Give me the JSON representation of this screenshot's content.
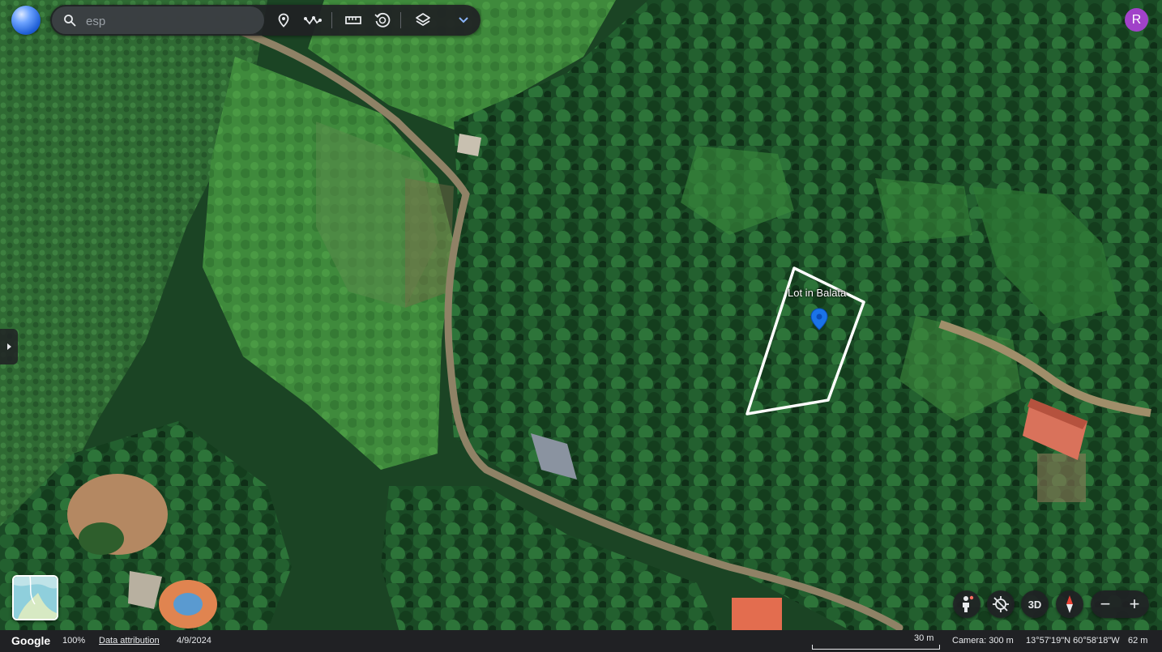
{
  "search": {
    "value": "esp"
  },
  "toolbar": {
    "icons": [
      "pin-icon",
      "path-icon",
      "ruler-icon",
      "history-icon",
      "layers-icon",
      "chevron-down-icon"
    ]
  },
  "user": {
    "initial": "R",
    "color": "#a142c9"
  },
  "map": {
    "placemark_label": "Lot in Balata",
    "pin_color": "#1a73e8",
    "polygon_color": "#ffffff"
  },
  "controls": {
    "view_3d_label": "3D",
    "zoom_out": "−",
    "zoom_in": "+"
  },
  "status": {
    "brand": "Google",
    "zoom": "100%",
    "attribution": "Data attribution",
    "date": "4/9/2024",
    "scale": "30 m",
    "camera": "Camera: 300 m",
    "coordinates": "13°57'19\"N 60°58'18\"W",
    "elevation": "62 m"
  }
}
